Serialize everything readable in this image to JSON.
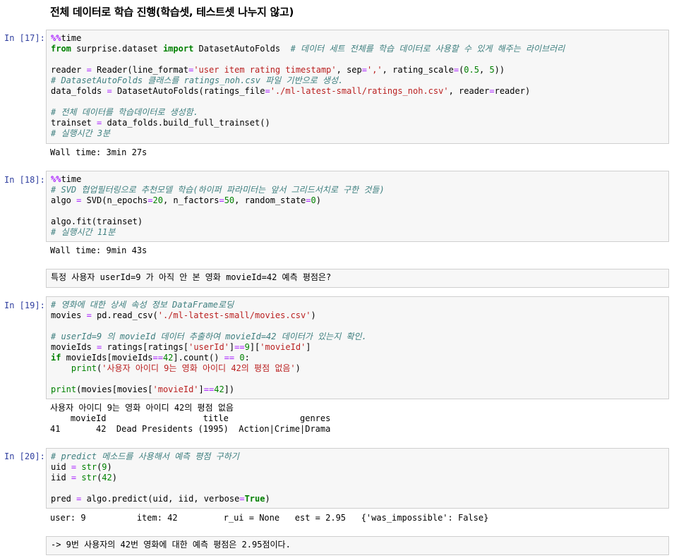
{
  "heading": "전체 데이터로 학습 진행(학습셋, 테스트셋 나누지 않고)",
  "cells": [
    {
      "prompt": "In [17]:",
      "lines": [
        [
          {
            "c": "mag",
            "t": "%%"
          },
          {
            "t": "time"
          }
        ],
        [
          {
            "c": "kw",
            "t": "from"
          },
          {
            "t": " surprise.dataset "
          },
          {
            "c": "kw",
            "t": "import"
          },
          {
            "t": " DatasetAutoFolds  "
          },
          {
            "c": "cm",
            "t": "# 데이터 세트 전체를 학습 데이터로 사용할 수 있게 해주는 라이브러리"
          }
        ],
        [
          {
            "t": ""
          }
        ],
        [
          {
            "t": "reader "
          },
          {
            "c": "op",
            "t": "="
          },
          {
            "t": " Reader(line_format"
          },
          {
            "c": "op",
            "t": "="
          },
          {
            "c": "st",
            "t": "'user item rating timestamp'"
          },
          {
            "t": ", sep"
          },
          {
            "c": "op",
            "t": "="
          },
          {
            "c": "st",
            "t": "','"
          },
          {
            "t": ", rating_scale"
          },
          {
            "c": "op",
            "t": "="
          },
          {
            "t": "("
          },
          {
            "c": "nm",
            "t": "0.5"
          },
          {
            "t": ", "
          },
          {
            "c": "nm",
            "t": "5"
          },
          {
            "t": "))"
          }
        ],
        [
          {
            "c": "cm",
            "t": "# DatasetAutoFolds 클래스를 ratings_noh.csv 파일 기반으로 생성."
          }
        ],
        [
          {
            "t": "data_folds "
          },
          {
            "c": "op",
            "t": "="
          },
          {
            "t": " DatasetAutoFolds(ratings_file"
          },
          {
            "c": "op",
            "t": "="
          },
          {
            "c": "st",
            "t": "'./ml-latest-small/ratings_noh.csv'"
          },
          {
            "t": ", reader"
          },
          {
            "c": "op",
            "t": "="
          },
          {
            "t": "reader)"
          }
        ],
        [
          {
            "t": ""
          }
        ],
        [
          {
            "c": "cm",
            "t": "# 전체 데이터를 학습데이터로 생성함."
          }
        ],
        [
          {
            "t": "trainset "
          },
          {
            "c": "op",
            "t": "="
          },
          {
            "t": " data_folds.build_full_trainset()"
          }
        ],
        [
          {
            "c": "cm",
            "t": "# 실행시간 3분"
          }
        ]
      ],
      "output": "Wall time: 3min 27s"
    },
    {
      "prompt": "In [18]:",
      "lines": [
        [
          {
            "c": "mag",
            "t": "%%"
          },
          {
            "t": "time"
          }
        ],
        [
          {
            "c": "cm",
            "t": "# SVD 협업필터링으로 추천모델 학습(하이퍼 파라미터는 앞서 그리드서치로 구한 것들)"
          }
        ],
        [
          {
            "t": "algo "
          },
          {
            "c": "op",
            "t": "="
          },
          {
            "t": " SVD(n_epochs"
          },
          {
            "c": "op",
            "t": "="
          },
          {
            "c": "nm",
            "t": "20"
          },
          {
            "t": ", n_factors"
          },
          {
            "c": "op",
            "t": "="
          },
          {
            "c": "nm",
            "t": "50"
          },
          {
            "t": ", random_state"
          },
          {
            "c": "op",
            "t": "="
          },
          {
            "c": "nm",
            "t": "0"
          },
          {
            "t": ")"
          }
        ],
        [
          {
            "t": ""
          }
        ],
        [
          {
            "t": "algo.fit(trainset)"
          }
        ],
        [
          {
            "c": "cm",
            "t": "# 실행시간 11분"
          }
        ]
      ],
      "output": "Wall time: 9min 43s"
    },
    {
      "prompt": "In [19]:",
      "lines": [
        [
          {
            "c": "cm",
            "t": "# 영화에 대한 상세 속성 정보 DataFrame로딩"
          }
        ],
        [
          {
            "t": "movies "
          },
          {
            "c": "op",
            "t": "="
          },
          {
            "t": " pd.read_csv("
          },
          {
            "c": "st",
            "t": "'./ml-latest-small/movies.csv'"
          },
          {
            "t": ")"
          }
        ],
        [
          {
            "t": ""
          }
        ],
        [
          {
            "c": "cm",
            "t": "# userId=9 의 movieId 데이터 추출하여 movieId=42 데이터가 있는지 확인."
          }
        ],
        [
          {
            "t": "movieIds "
          },
          {
            "c": "op",
            "t": "="
          },
          {
            "t": " ratings[ratings["
          },
          {
            "c": "st",
            "t": "'userId'"
          },
          {
            "t": "]"
          },
          {
            "c": "op",
            "t": "=="
          },
          {
            "c": "nm",
            "t": "9"
          },
          {
            "t": "]["
          },
          {
            "c": "st",
            "t": "'movieId'"
          },
          {
            "t": "]"
          }
        ],
        [
          {
            "c": "kw",
            "t": "if"
          },
          {
            "t": " movieIds[movieIds"
          },
          {
            "c": "op",
            "t": "=="
          },
          {
            "c": "nm",
            "t": "42"
          },
          {
            "t": "].count() "
          },
          {
            "c": "op",
            "t": "=="
          },
          {
            "t": " "
          },
          {
            "c": "nm",
            "t": "0"
          },
          {
            "t": ":"
          }
        ],
        [
          {
            "t": "    "
          },
          {
            "c": "bi",
            "t": "print"
          },
          {
            "t": "("
          },
          {
            "c": "st",
            "t": "'사용자 아이디 9는 영화 아이디 42의 평점 없음'"
          },
          {
            "t": ")"
          }
        ],
        [
          {
            "t": ""
          }
        ],
        [
          {
            "c": "bi",
            "t": "print"
          },
          {
            "t": "(movies[movies["
          },
          {
            "c": "st",
            "t": "'movieId'"
          },
          {
            "t": "]"
          },
          {
            "c": "op",
            "t": "=="
          },
          {
            "c": "nm",
            "t": "42"
          },
          {
            "t": "])"
          }
        ]
      ],
      "output": "사용자 아이디 9는 영화 아이디 42의 평점 없음\n    movieId                   title              genres\n41       42  Dead Presidents (1995)  Action|Crime|Drama"
    },
    {
      "prompt": "In [20]:",
      "lines": [
        [
          {
            "c": "cm",
            "t": "# predict 메소드를 사용해서 예측 평점 구하기"
          }
        ],
        [
          {
            "t": "uid "
          },
          {
            "c": "op",
            "t": "="
          },
          {
            "t": " "
          },
          {
            "c": "bi",
            "t": "str"
          },
          {
            "t": "("
          },
          {
            "c": "nm",
            "t": "9"
          },
          {
            "t": ")"
          }
        ],
        [
          {
            "t": "iid "
          },
          {
            "c": "op",
            "t": "="
          },
          {
            "t": " "
          },
          {
            "c": "bi",
            "t": "str"
          },
          {
            "t": "("
          },
          {
            "c": "nm",
            "t": "42"
          },
          {
            "t": ")"
          }
        ],
        [
          {
            "t": ""
          }
        ],
        [
          {
            "t": "pred "
          },
          {
            "c": "op",
            "t": "="
          },
          {
            "t": " algo.predict(uid, iid, verbose"
          },
          {
            "c": "op",
            "t": "="
          },
          {
            "c": "kv",
            "t": "True"
          },
          {
            "t": ")"
          }
        ]
      ],
      "output": "user: 9          item: 42         r_ui = None   est = 2.95   {'was_impossible': False}"
    }
  ],
  "markdown": {
    "note1": "특정 사용자 userId=9 가 아직 안 본 영화 movieId=42 예측 평점은?",
    "note2": "-> 9번 사용자의 42번 영화에 대한 예측 평점은 2.95점이다."
  }
}
